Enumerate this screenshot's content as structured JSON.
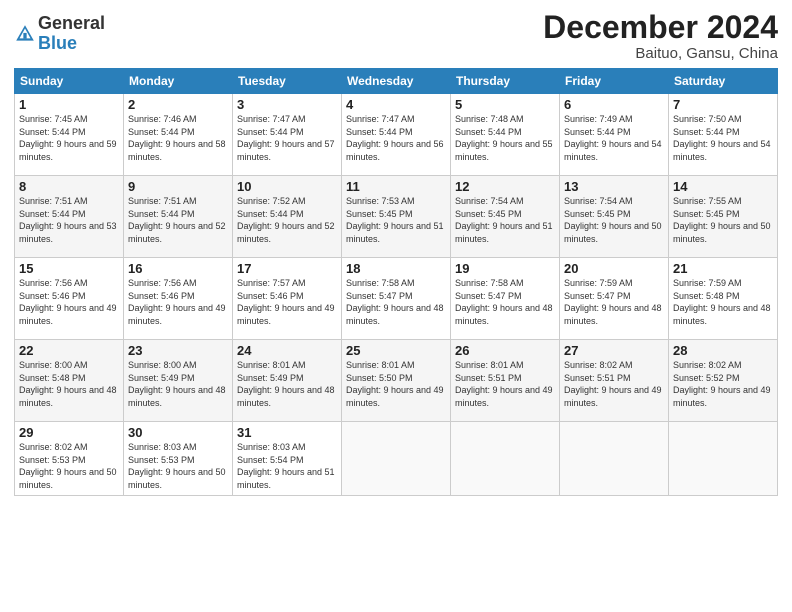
{
  "header": {
    "logo_line1": "General",
    "logo_line2": "Blue",
    "month": "December 2024",
    "location": "Baituo, Gansu, China"
  },
  "weekdays": [
    "Sunday",
    "Monday",
    "Tuesday",
    "Wednesday",
    "Thursday",
    "Friday",
    "Saturday"
  ],
  "weeks": [
    [
      {
        "day": "1",
        "sunrise": "Sunrise: 7:45 AM",
        "sunset": "Sunset: 5:44 PM",
        "daylight": "Daylight: 9 hours and 59 minutes."
      },
      {
        "day": "2",
        "sunrise": "Sunrise: 7:46 AM",
        "sunset": "Sunset: 5:44 PM",
        "daylight": "Daylight: 9 hours and 58 minutes."
      },
      {
        "day": "3",
        "sunrise": "Sunrise: 7:47 AM",
        "sunset": "Sunset: 5:44 PM",
        "daylight": "Daylight: 9 hours and 57 minutes."
      },
      {
        "day": "4",
        "sunrise": "Sunrise: 7:47 AM",
        "sunset": "Sunset: 5:44 PM",
        "daylight": "Daylight: 9 hours and 56 minutes."
      },
      {
        "day": "5",
        "sunrise": "Sunrise: 7:48 AM",
        "sunset": "Sunset: 5:44 PM",
        "daylight": "Daylight: 9 hours and 55 minutes."
      },
      {
        "day": "6",
        "sunrise": "Sunrise: 7:49 AM",
        "sunset": "Sunset: 5:44 PM",
        "daylight": "Daylight: 9 hours and 54 minutes."
      },
      {
        "day": "7",
        "sunrise": "Sunrise: 7:50 AM",
        "sunset": "Sunset: 5:44 PM",
        "daylight": "Daylight: 9 hours and 54 minutes."
      }
    ],
    [
      {
        "day": "8",
        "sunrise": "Sunrise: 7:51 AM",
        "sunset": "Sunset: 5:44 PM",
        "daylight": "Daylight: 9 hours and 53 minutes."
      },
      {
        "day": "9",
        "sunrise": "Sunrise: 7:51 AM",
        "sunset": "Sunset: 5:44 PM",
        "daylight": "Daylight: 9 hours and 52 minutes."
      },
      {
        "day": "10",
        "sunrise": "Sunrise: 7:52 AM",
        "sunset": "Sunset: 5:44 PM",
        "daylight": "Daylight: 9 hours and 52 minutes."
      },
      {
        "day": "11",
        "sunrise": "Sunrise: 7:53 AM",
        "sunset": "Sunset: 5:45 PM",
        "daylight": "Daylight: 9 hours and 51 minutes."
      },
      {
        "day": "12",
        "sunrise": "Sunrise: 7:54 AM",
        "sunset": "Sunset: 5:45 PM",
        "daylight": "Daylight: 9 hours and 51 minutes."
      },
      {
        "day": "13",
        "sunrise": "Sunrise: 7:54 AM",
        "sunset": "Sunset: 5:45 PM",
        "daylight": "Daylight: 9 hours and 50 minutes."
      },
      {
        "day": "14",
        "sunrise": "Sunrise: 7:55 AM",
        "sunset": "Sunset: 5:45 PM",
        "daylight": "Daylight: 9 hours and 50 minutes."
      }
    ],
    [
      {
        "day": "15",
        "sunrise": "Sunrise: 7:56 AM",
        "sunset": "Sunset: 5:46 PM",
        "daylight": "Daylight: 9 hours and 49 minutes."
      },
      {
        "day": "16",
        "sunrise": "Sunrise: 7:56 AM",
        "sunset": "Sunset: 5:46 PM",
        "daylight": "Daylight: 9 hours and 49 minutes."
      },
      {
        "day": "17",
        "sunrise": "Sunrise: 7:57 AM",
        "sunset": "Sunset: 5:46 PM",
        "daylight": "Daylight: 9 hours and 49 minutes."
      },
      {
        "day": "18",
        "sunrise": "Sunrise: 7:58 AM",
        "sunset": "Sunset: 5:47 PM",
        "daylight": "Daylight: 9 hours and 48 minutes."
      },
      {
        "day": "19",
        "sunrise": "Sunrise: 7:58 AM",
        "sunset": "Sunset: 5:47 PM",
        "daylight": "Daylight: 9 hours and 48 minutes."
      },
      {
        "day": "20",
        "sunrise": "Sunrise: 7:59 AM",
        "sunset": "Sunset: 5:47 PM",
        "daylight": "Daylight: 9 hours and 48 minutes."
      },
      {
        "day": "21",
        "sunrise": "Sunrise: 7:59 AM",
        "sunset": "Sunset: 5:48 PM",
        "daylight": "Daylight: 9 hours and 48 minutes."
      }
    ],
    [
      {
        "day": "22",
        "sunrise": "Sunrise: 8:00 AM",
        "sunset": "Sunset: 5:48 PM",
        "daylight": "Daylight: 9 hours and 48 minutes."
      },
      {
        "day": "23",
        "sunrise": "Sunrise: 8:00 AM",
        "sunset": "Sunset: 5:49 PM",
        "daylight": "Daylight: 9 hours and 48 minutes."
      },
      {
        "day": "24",
        "sunrise": "Sunrise: 8:01 AM",
        "sunset": "Sunset: 5:49 PM",
        "daylight": "Daylight: 9 hours and 48 minutes."
      },
      {
        "day": "25",
        "sunrise": "Sunrise: 8:01 AM",
        "sunset": "Sunset: 5:50 PM",
        "daylight": "Daylight: 9 hours and 49 minutes."
      },
      {
        "day": "26",
        "sunrise": "Sunrise: 8:01 AM",
        "sunset": "Sunset: 5:51 PM",
        "daylight": "Daylight: 9 hours and 49 minutes."
      },
      {
        "day": "27",
        "sunrise": "Sunrise: 8:02 AM",
        "sunset": "Sunset: 5:51 PM",
        "daylight": "Daylight: 9 hours and 49 minutes."
      },
      {
        "day": "28",
        "sunrise": "Sunrise: 8:02 AM",
        "sunset": "Sunset: 5:52 PM",
        "daylight": "Daylight: 9 hours and 49 minutes."
      }
    ],
    [
      {
        "day": "29",
        "sunrise": "Sunrise: 8:02 AM",
        "sunset": "Sunset: 5:53 PM",
        "daylight": "Daylight: 9 hours and 50 minutes."
      },
      {
        "day": "30",
        "sunrise": "Sunrise: 8:03 AM",
        "sunset": "Sunset: 5:53 PM",
        "daylight": "Daylight: 9 hours and 50 minutes."
      },
      {
        "day": "31",
        "sunrise": "Sunrise: 8:03 AM",
        "sunset": "Sunset: 5:54 PM",
        "daylight": "Daylight: 9 hours and 51 minutes."
      },
      null,
      null,
      null,
      null
    ]
  ]
}
